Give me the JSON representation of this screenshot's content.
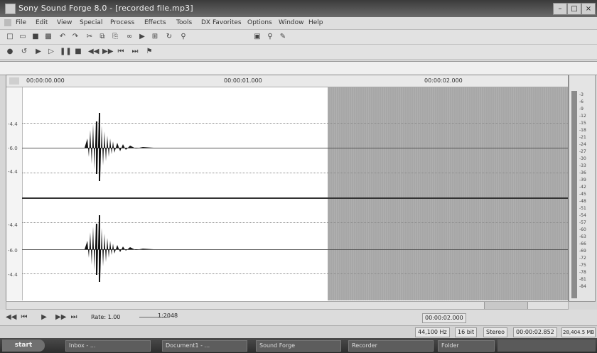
{
  "window": {
    "title": "Sony Sound Forge 8.0 - [recorded file.mp3]"
  },
  "menu": [
    "File",
    "Edit",
    "View",
    "Special",
    "Process",
    "Effects",
    "Tools",
    "DX Favorites",
    "Options",
    "Window",
    "Help"
  ],
  "timeline": {
    "marks": [
      "00:00:00.000",
      "00:00:01.000",
      "00:00:02.000"
    ]
  },
  "channels": {
    "left_labels": [
      "-4.4",
      "-6.0",
      "-4.4"
    ],
    "right_labels": [
      "-4.4",
      "-6.0",
      "-4.4"
    ]
  },
  "meter": {
    "scale": [
      "-3",
      "-6",
      "-9",
      "-12",
      "-15",
      "-18",
      "-21",
      "-24",
      "-27",
      "-30",
      "-33",
      "-36",
      "-39",
      "-42",
      "-45",
      "-48",
      "-51",
      "-54",
      "-57",
      "-60",
      "-63",
      "-66",
      "-69",
      "-72",
      "-75",
      "-78",
      "-81",
      "-84"
    ]
  },
  "transport": {
    "rate_label": "Rate: 1.00",
    "zoom_label": "1:2048"
  },
  "status": {
    "selection": "00:00:02.000",
    "sample_rate": "44,100 Hz",
    "bit_depth": "16 bit",
    "channels": "Stereo",
    "length": "00:00:02.852",
    "free_space": "28,404.5 MB"
  },
  "taskbar": {
    "start": "start",
    "tasks": [
      "Inbox - ...",
      "Document1 - ...",
      "Sound Forge",
      "Recorder",
      "Folder"
    ]
  }
}
